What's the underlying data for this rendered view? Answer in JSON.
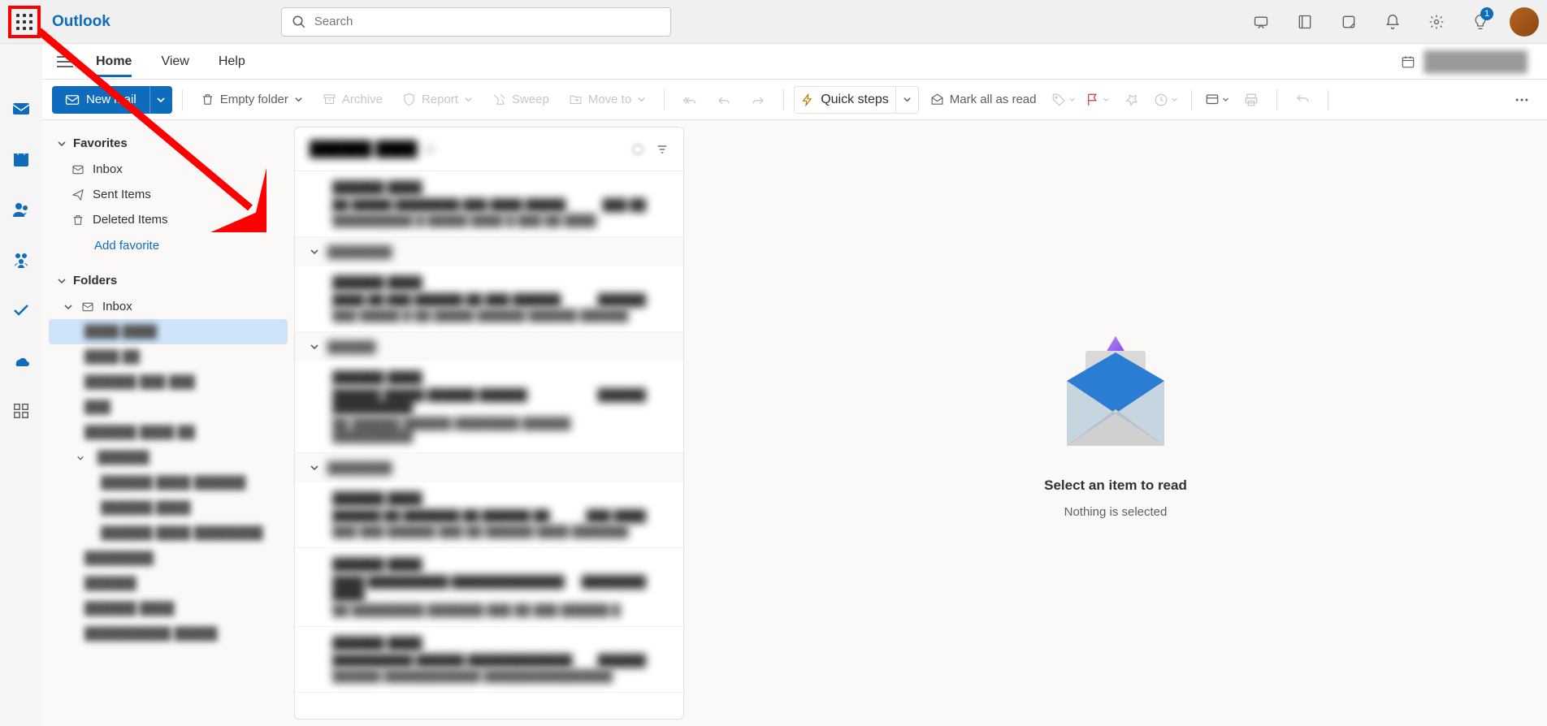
{
  "app": {
    "title": "Outlook"
  },
  "search": {
    "placeholder": "Search"
  },
  "notifications": {
    "tips_badge": "1"
  },
  "menu": {
    "home": "Home",
    "view": "View",
    "help": "Help"
  },
  "ribbon": {
    "new_mail": "New mail",
    "empty_folder": "Empty folder",
    "archive": "Archive",
    "report": "Report",
    "sweep": "Sweep",
    "move_to": "Move to",
    "quick_steps": "Quick steps",
    "mark_all_read": "Mark all as read"
  },
  "folders": {
    "favorites_label": "Favorites",
    "inbox": "Inbox",
    "sent": "Sent Items",
    "deleted": "Deleted Items",
    "add_favorite": "Add favorite",
    "folders_label": "Folders",
    "inbox2": "Inbox"
  },
  "reading": {
    "title": "Select an item to read",
    "subtitle": "Nothing is selected"
  }
}
